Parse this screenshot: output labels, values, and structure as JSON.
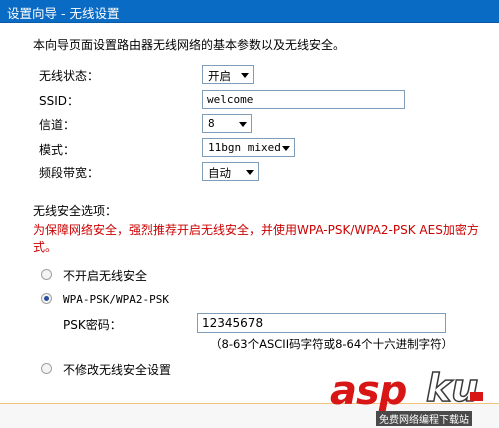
{
  "header": {
    "title": "设置向导 - 无线设置"
  },
  "intro": "本向导页面设置路由器无线网络的基本参数以及无线安全。",
  "fields": {
    "wireless_status": {
      "label": "无线状态：",
      "value": "开启"
    },
    "ssid": {
      "label": "SSID：",
      "value": "welcome"
    },
    "channel": {
      "label": "信道：",
      "value": "8"
    },
    "mode": {
      "label": "模式：",
      "value": "11bgn mixed"
    },
    "bandwidth": {
      "label": "频段带宽：",
      "value": "自动"
    }
  },
  "security": {
    "section_label": "无线安全选项：",
    "warning": "为保障网络安全，强烈推荐开启无线安全，并使用WPA-PSK/WPA2-PSK AES加密方式。",
    "options": {
      "disable": "不开启无线安全",
      "wpa": "WPA-PSK/WPA2-PSK",
      "keep": "不修改无线安全设置"
    },
    "selected": "wpa",
    "psk_label": "PSK密码：",
    "psk_value": "12345678",
    "psk_hint": "（8-63个ASCII码字符或8-64个十六进制字符）"
  },
  "watermark": {
    "brand_red": "asp",
    "brand_outline": "ku",
    "sub": "免费网络编程下载站"
  },
  "colors": {
    "titlebar": "#0a6bc4",
    "warning": "#cc0000",
    "watermark_red": "#d81616"
  }
}
